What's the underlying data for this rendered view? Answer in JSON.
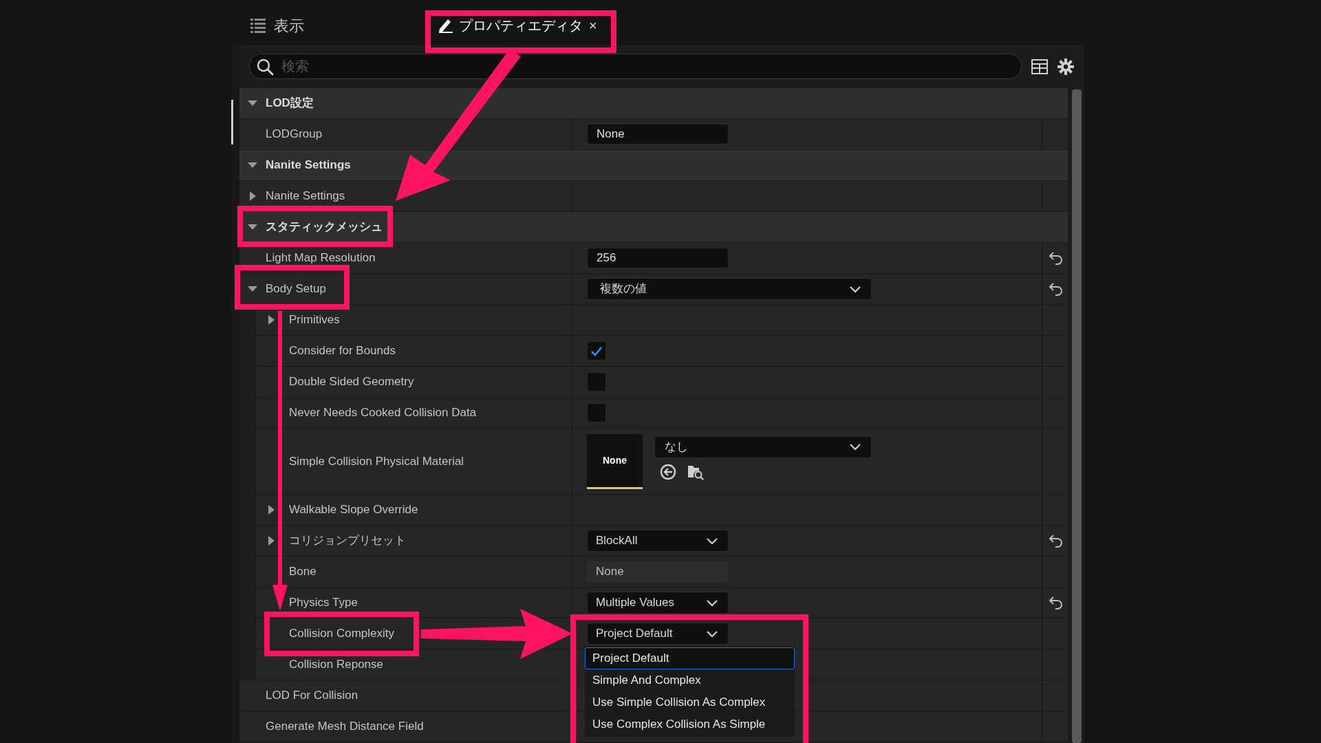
{
  "tabs": [
    {
      "label": "表示",
      "selected": false
    },
    {
      "label": "プロパティエディタ",
      "close": "×",
      "selected": true
    }
  ],
  "search": {
    "placeholder": "検索"
  },
  "categories": [
    {
      "label": "LOD設定",
      "expanded": true,
      "properties": [
        {
          "label": "LODGroup",
          "value": {
            "kind": "field",
            "text": "None"
          }
        }
      ]
    },
    {
      "label": "Nanite Settings",
      "expanded": true,
      "properties": [
        {
          "label": "Nanite Settings",
          "expanded": false
        }
      ]
    },
    {
      "label": "スタティックメッシュ",
      "expanded": true,
      "properties": [
        {
          "label": "Light Map Resolution",
          "value": {
            "kind": "field",
            "text": "256"
          },
          "resettable": true
        },
        {
          "label": "Body Setup",
          "expanded": true,
          "value": {
            "kind": "wide-combo",
            "text": "複数の値"
          },
          "resettable": true,
          "children": [
            {
              "label": "Primitives",
              "expanded": false
            },
            {
              "label": "Consider for Bounds",
              "value": {
                "kind": "checkbox",
                "checked": true
              }
            },
            {
              "label": "Double Sided Geometry",
              "value": {
                "kind": "checkbox",
                "checked": false
              }
            },
            {
              "label": "Never Needs Cooked Collision Data",
              "value": {
                "kind": "checkbox",
                "checked": false
              }
            },
            {
              "label": "Simple Collision Physical Material",
              "value": {
                "kind": "asset",
                "thumb": "None",
                "text": "なし"
              }
            },
            {
              "label": "Walkable Slope Override",
              "expanded": false
            },
            {
              "label": "コリジョンプリセット",
              "expanded": false,
              "value": {
                "kind": "combo",
                "text": "BlockAll"
              },
              "resettable": true
            },
            {
              "label": "Bone",
              "value": {
                "kind": "readonly-field",
                "text": "None"
              }
            },
            {
              "label": "Physics Type",
              "value": {
                "kind": "combo",
                "text": "Multiple Values"
              },
              "resettable": true
            },
            {
              "label": "Collision Complexity",
              "value": {
                "kind": "combo",
                "text": "Project Default",
                "open": true,
                "options": [
                  {
                    "label": "Project Default",
                    "selected": true
                  },
                  {
                    "label": "Simple And Complex",
                    "selected": false
                  },
                  {
                    "label": "Use Simple Collision As Complex",
                    "selected": false
                  },
                  {
                    "label": "Use Complex Collision As Simple",
                    "selected": false
                  }
                ]
              }
            },
            {
              "label": "Collision Reponse"
            }
          ]
        },
        {
          "label": "LOD For Collision"
        },
        {
          "label": "Generate Mesh Distance Field"
        }
      ]
    }
  ]
}
